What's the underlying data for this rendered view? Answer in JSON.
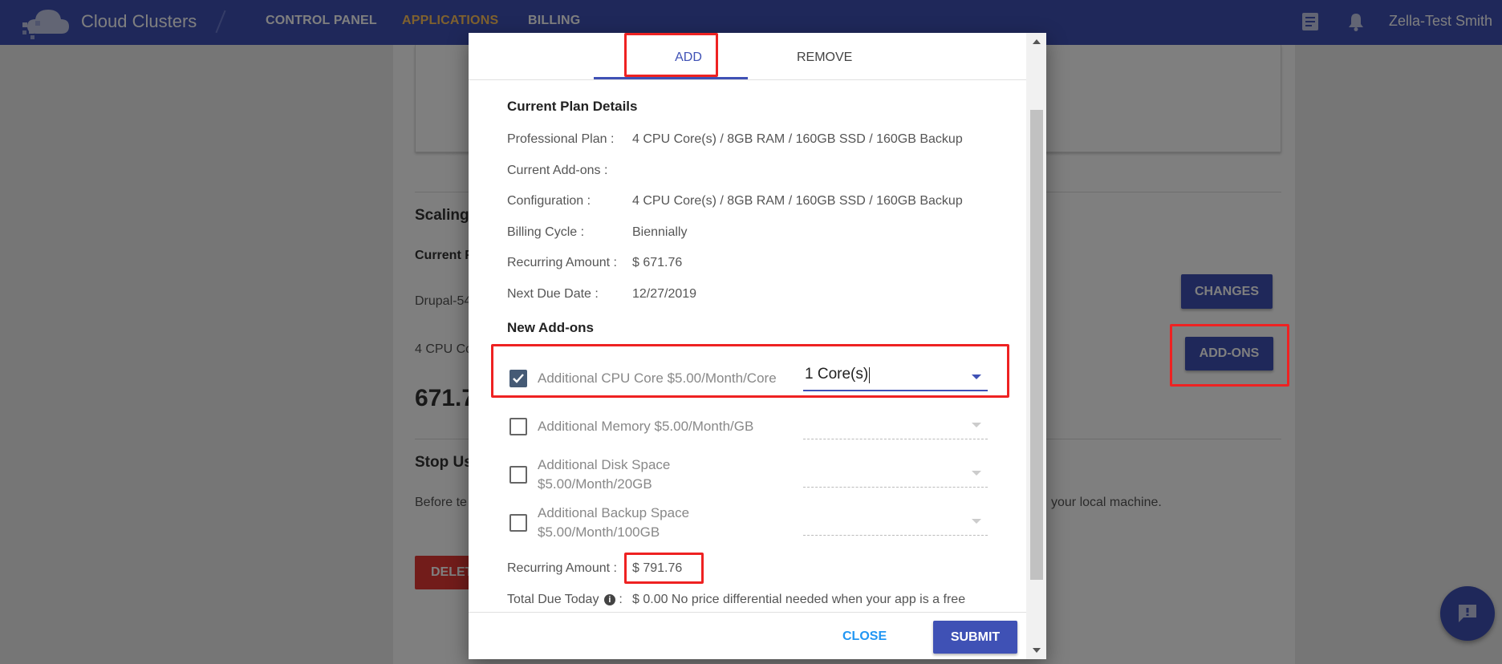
{
  "topbar": {
    "brand": "Cloud Clusters",
    "nav": [
      "CONTROL PANEL",
      "APPLICATIONS",
      "BILLING"
    ],
    "active_nav": "APPLICATIONS",
    "user": "Zella-Test Smith",
    "icons": [
      "document-icon",
      "bell-icon"
    ]
  },
  "background": {
    "scaling_heading": "Scaling",
    "current_label": "Current F",
    "app_name": "Drupal-54",
    "config_snippet": "4 CPU Co",
    "amount_snippet": "671.7",
    "stop_heading": "Stop Us",
    "before_text": "Before te",
    "local_machine_text": "your local machine.",
    "changes_button": "CHANGES",
    "addons_button": "ADD-ONS",
    "delete_button": "DELETE"
  },
  "modal": {
    "tabs": [
      "ADD",
      "REMOVE"
    ],
    "current_plan_title": "Current Plan Details",
    "plan_rows": [
      {
        "label": "Professional Plan :",
        "value": "4 CPU Core(s) / 8GB RAM / 160GB SSD / 160GB Backup"
      },
      {
        "label": "Current Add-ons :",
        "value": ""
      },
      {
        "label": "Configuration :",
        "value": "4 CPU Core(s) / 8GB RAM / 160GB SSD / 160GB Backup"
      },
      {
        "label": "Billing Cycle :",
        "value": "Biennially"
      },
      {
        "label": "Recurring Amount :",
        "value": "$ 671.76"
      },
      {
        "label": "Next Due Date :",
        "value": "12/27/2019"
      }
    ],
    "new_addons_title": "New Add-ons",
    "addons": [
      {
        "label": "Additional CPU Core $5.00/Month/Core",
        "checked": true,
        "selected": "1 Core(s)"
      },
      {
        "label": "Additional Memory $5.00/Month/GB",
        "checked": false,
        "selected": ""
      },
      {
        "label_line1": "Additional Disk Space",
        "label_line2": "$5.00/Month/20GB",
        "checked": false,
        "selected": ""
      },
      {
        "label_line1": "Additional Backup Space",
        "label_line2": "$5.00/Month/100GB",
        "checked": false,
        "selected": ""
      }
    ],
    "recurring_label": "Recurring Amount :",
    "recurring_value": "$ 791.76",
    "total_due_label": "Total Due Today",
    "total_due_suffix": ":",
    "total_due_value": "$ 0.00 No price differential needed when your app is a free",
    "info_glyph": "i",
    "close_button": "CLOSE",
    "submit_button": "SUBMIT"
  },
  "chat_button_icon": "chat-icon",
  "colors": {
    "primary": "#3f51b5",
    "active_nav": "#ffc35c",
    "danger": "#e53935",
    "highlight": "#ee2222",
    "link": "#2196f3"
  }
}
